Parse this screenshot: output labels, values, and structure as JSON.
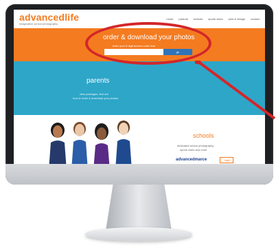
{
  "brand": {
    "logo_main": "advanced",
    "logo_accent": "life",
    "tagline": "imaginative school photography"
  },
  "nav": {
    "items": [
      "home",
      "parents",
      "schools",
      "sports clubs",
      "print & design",
      "contact"
    ]
  },
  "hero": {
    "title": "order & download your photos",
    "subtitle": "enter your 8 digit access code here",
    "input_placeholder": "",
    "button_label": "go"
  },
  "parents": {
    "title": "parents",
    "line1": "view packages, find out",
    "line2": "how to order & download your photos"
  },
  "schools": {
    "title": "schools",
    "line1": "dedicated school photography",
    "line2": "sports clubs and more",
    "brand": "advancedmarce",
    "login_label": "login"
  },
  "colors": {
    "orange": "#f47b20",
    "blue": "#2ea6c8",
    "annotation_red": "#d3262a",
    "navy": "#1b3f8f"
  }
}
